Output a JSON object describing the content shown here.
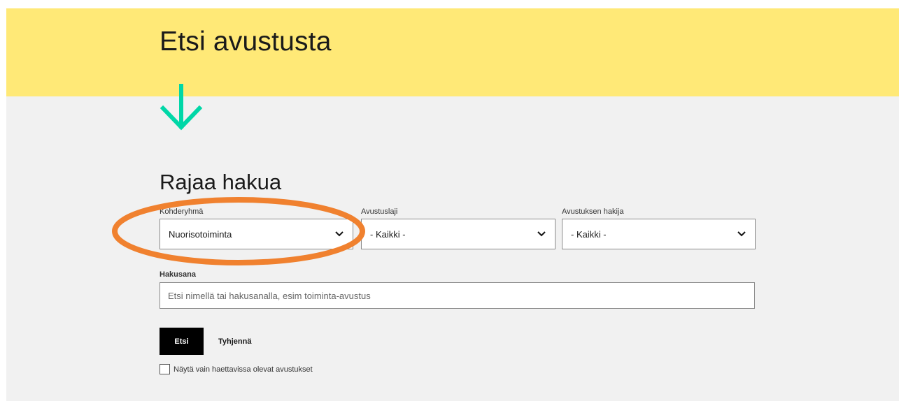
{
  "header": {
    "title": "Etsi avustusta",
    "background_color": "#ffe977",
    "arrow_icon": "arrow-down-icon",
    "arrow_color": "#00d7a7"
  },
  "filters": {
    "title": "Rajaa hakua",
    "target_group": {
      "label": "Kohderyhmä",
      "value": "Nuorisotoiminta"
    },
    "grant_type": {
      "label": "Avustuslaji",
      "value": "- Kaikki -"
    },
    "applicant": {
      "label": "Avustuksen hakija",
      "value": "- Kaikki -"
    },
    "keyword": {
      "label": "Hakusana",
      "value": "",
      "placeholder": "Etsi nimellä tai hakusanalla, esim toiminta-avustus"
    },
    "search_button": "Etsi",
    "clear_button": "Tyhjennä",
    "open_only": {
      "label": "Näytä vain haettavissa olevat avustukset",
      "checked": false
    }
  },
  "annotation": {
    "shape": "ellipse",
    "color": "#f0812f"
  }
}
